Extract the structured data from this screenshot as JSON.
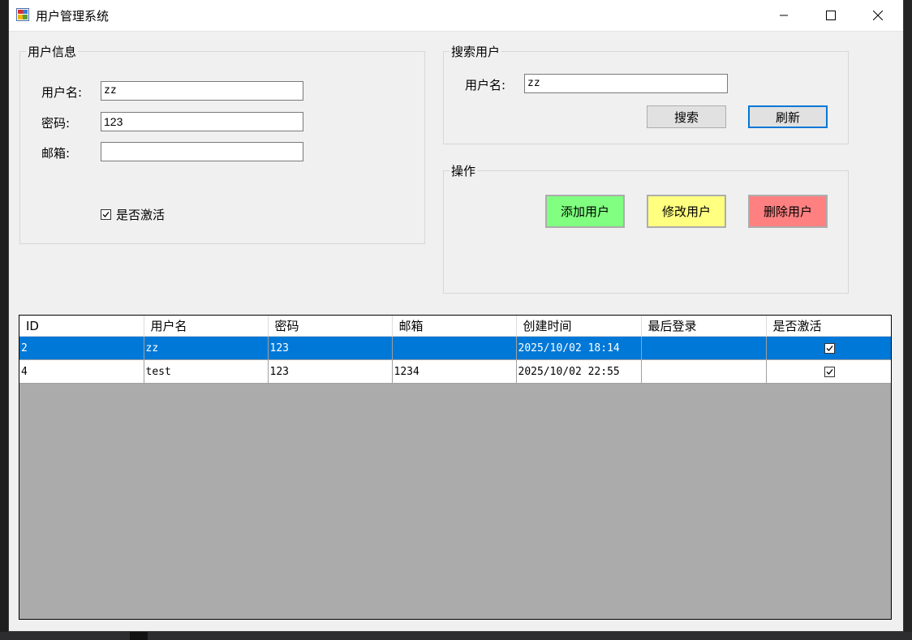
{
  "window": {
    "title": "用户管理系统"
  },
  "user_info": {
    "legend": "用户信息",
    "username_label": "用户名:",
    "username_value": "zz",
    "password_label": "密码:",
    "password_value": "123",
    "email_label": "邮箱:",
    "email_value": "",
    "active_label": "是否激活",
    "active_checked": true
  },
  "search": {
    "legend": "搜索用户",
    "username_label": "用户名:",
    "username_value": "zz",
    "search_button": "搜索",
    "refresh_button": "刷新"
  },
  "operations": {
    "legend": "操作",
    "add_button": "添加用户",
    "edit_button": "修改用户",
    "delete_button": "删除用户",
    "colors": {
      "add": "#80ff80",
      "edit": "#ffff80",
      "delete": "#ff8080"
    }
  },
  "grid": {
    "columns": [
      "ID",
      "用户名",
      "密码",
      "邮箱",
      "创建时间",
      "最后登录",
      "是否激活"
    ],
    "rows": [
      [
        "2",
        "zz",
        "123",
        "",
        "2025/10/02 18:14",
        "",
        true
      ],
      [
        "4",
        "test",
        "123",
        "1234",
        "2025/10/02 22:55",
        "",
        true
      ]
    ],
    "selected_row": 0,
    "selection_color": "#0078d7"
  }
}
